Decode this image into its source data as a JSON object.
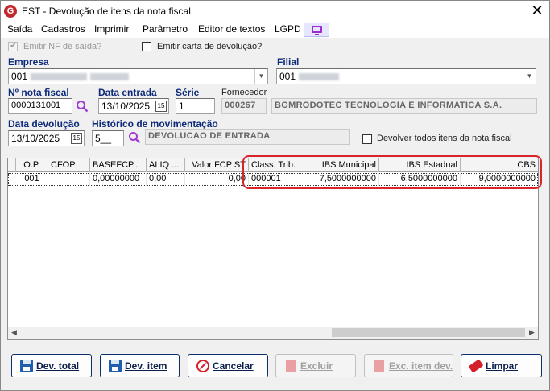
{
  "window": {
    "title": "EST - Devolução de itens da nota fiscal",
    "app_icon_letter": "G"
  },
  "menu": [
    "Saída",
    "Cadastros",
    "Imprimir",
    "Parâmetro",
    "Editor de textos",
    "LGPD"
  ],
  "options": {
    "emitir_nf_saida": {
      "label": "Emitir NF de saída?",
      "checked": true,
      "enabled": false
    },
    "emitir_carta": {
      "label": "Emitir carta de devolução?",
      "checked": false
    }
  },
  "empresa": {
    "label": "Empresa",
    "value": "001"
  },
  "filial": {
    "label": "Filial",
    "value": "001"
  },
  "nota": {
    "label": "Nº nota fiscal",
    "value": "0000131001"
  },
  "data_entrada": {
    "label": "Data entrada",
    "value": "13/10/2025"
  },
  "serie": {
    "label": "Série",
    "value": "1"
  },
  "fornecedor": {
    "label": "Fornecedor",
    "code": "000267",
    "name": "BGMRODOTEC TECNOLOGIA E INFORMATICA S.A."
  },
  "data_devolucao": {
    "label": "Data devolução",
    "value": "13/10/2025"
  },
  "historico": {
    "label": "Histórico de movimentação",
    "code": "5__",
    "description": "DEVOLUCAO DE ENTRADA"
  },
  "devolver_todos": {
    "label": "Devolver todos itens da nota fiscal",
    "checked": false
  },
  "grid": {
    "columns": [
      "O.P.",
      "CFOP",
      "BASEFCP...",
      "ALIQ ...",
      "Valor FCP ST",
      "Class. Trib.",
      "IBS Municipal",
      "IBS Estadual",
      "CBS"
    ],
    "rows": [
      [
        "001",
        "",
        "0,00000000",
        "0,00",
        "0,00",
        "000001",
        "7,5000000000",
        "6,5000000000",
        "9,0000000000"
      ]
    ]
  },
  "buttons": {
    "dev_total": "Dev. total",
    "dev_item": "Dev. item",
    "cancelar": "Cancelar",
    "excluir": "Excluir",
    "exc_item_dev": "Exc. item dev.",
    "limpar": "Limpar"
  },
  "colors": {
    "label_blue": "#0d2a7a",
    "highlight_red": "#d9242c",
    "button_border": "#0a2f6b"
  }
}
